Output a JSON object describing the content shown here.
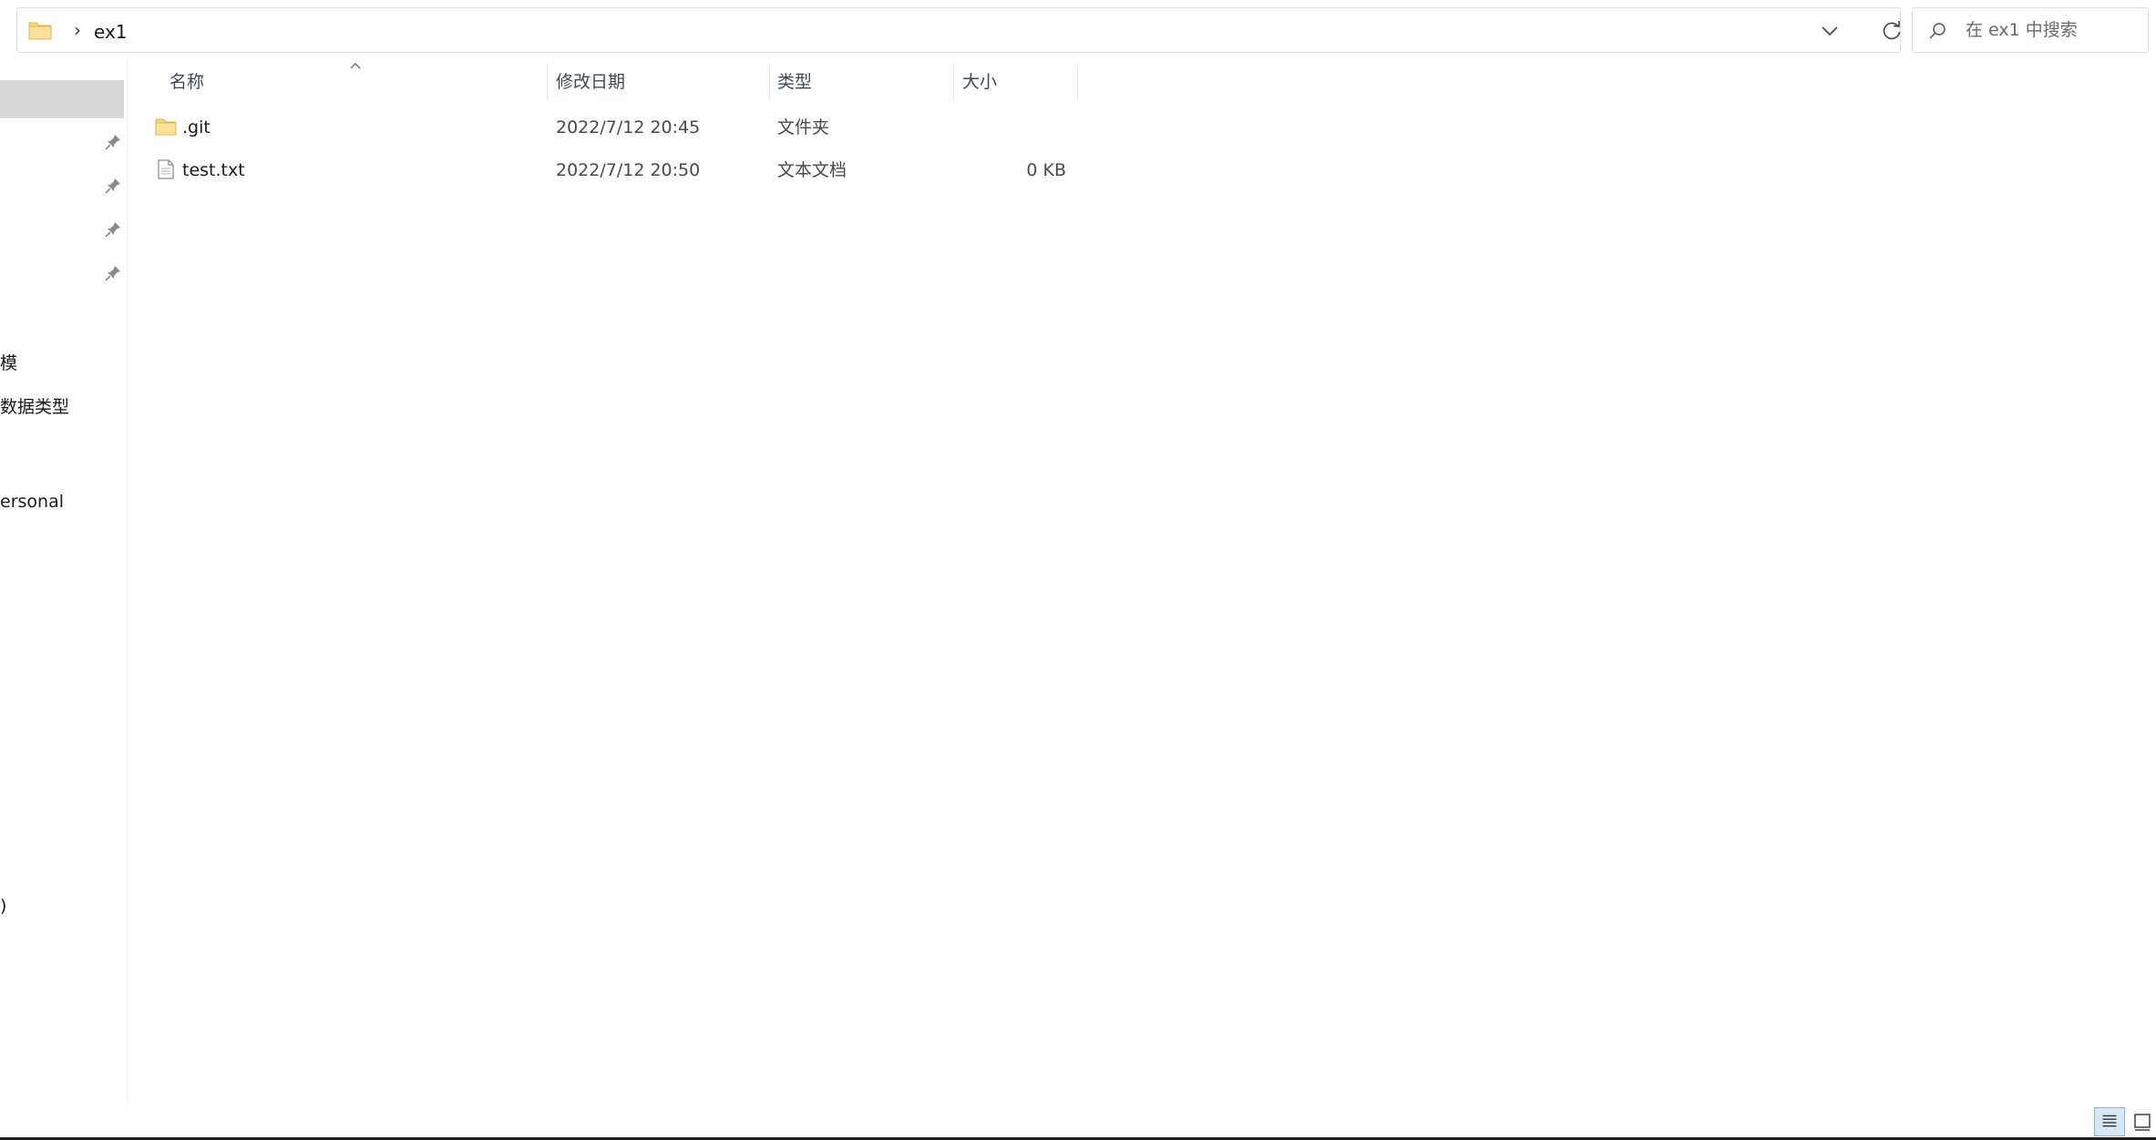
{
  "address": {
    "separator": "›",
    "crumb": "ex1"
  },
  "search": {
    "placeholder": "在 ex1 中搜索"
  },
  "nav": {
    "items": [
      {
        "label": "模"
      },
      {
        "label": "数据类型"
      },
      {
        "label": "ersonal"
      },
      {
        "label": ")"
      }
    ]
  },
  "columns": {
    "name": "名称",
    "modified": "修改日期",
    "type": "类型",
    "size": "大小"
  },
  "files": [
    {
      "name": ".git",
      "modified": "2022/7/12 20:45",
      "type": "文件夹",
      "size": "",
      "icon": "folder-icon"
    },
    {
      "name": "test.txt",
      "modified": "2022/7/12 20:50",
      "type": "文本文档",
      "size": "0 KB",
      "icon": "text-file-icon"
    }
  ],
  "colors": {
    "accent": "#0067c0",
    "folder": "#f8d775",
    "selection": "#d9d9d9"
  }
}
